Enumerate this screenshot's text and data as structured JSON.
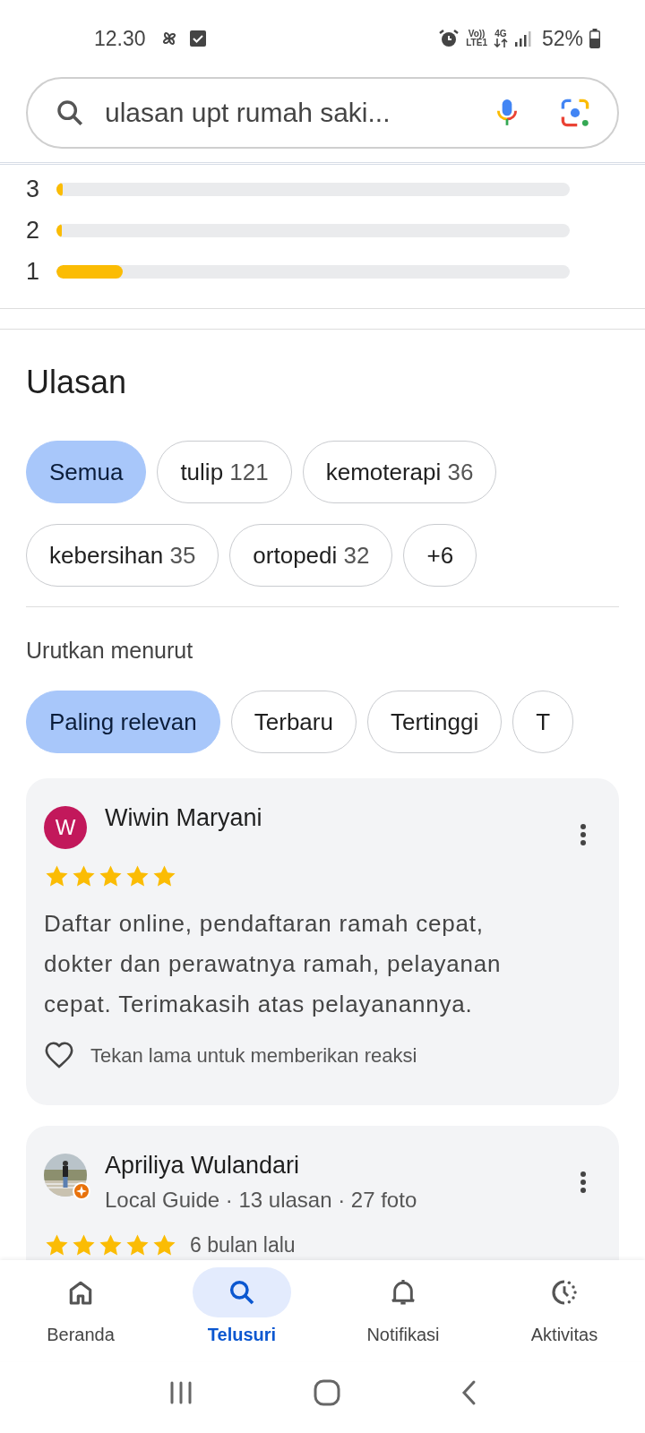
{
  "status_bar": {
    "time": "12.30",
    "volte_top": "Vo))",
    "volte_bottom": "LTE1",
    "network": "4G",
    "battery": "52%"
  },
  "search": {
    "value": "ulasan upt rumah saki..."
  },
  "rating_bars": [
    {
      "label": "3",
      "level": 0.012
    },
    {
      "label": "2",
      "level": 0.01
    },
    {
      "label": "1",
      "level": 0.13
    }
  ],
  "reviews_section": {
    "title": "Ulasan",
    "topics": [
      {
        "label": "Semua",
        "selected": true
      },
      {
        "label": "tulip",
        "count": "121",
        "selected": false
      },
      {
        "label": "kemoterapi",
        "count": "36",
        "selected": false
      },
      {
        "label": "kebersihan",
        "count": "35",
        "selected": false
      },
      {
        "label": "ortopedi",
        "count": "32",
        "selected": false
      },
      {
        "label": "+6",
        "selected": false
      }
    ]
  },
  "sort": {
    "label": "Urutkan menurut",
    "options": [
      {
        "label": "Paling relevan",
        "selected": true
      },
      {
        "label": "Terbaru",
        "selected": false
      },
      {
        "label": "Tertinggi",
        "selected": false
      },
      {
        "label": "T",
        "selected": false
      }
    ]
  },
  "reviews": [
    {
      "name": "Wiwin Maryani",
      "avatar": {
        "kind": "initial",
        "initial": "W",
        "color": "#c2185b"
      },
      "stars": 5,
      "text": "Daftar online, pendaftaran ramah cepat, dokter dan perawatnya ramah, pelayanan cepat. Terimakasih atas pelayanannya.",
      "reaction_hint": "Tekan lama untuk memberikan reaksi"
    },
    {
      "name": "Apriliya Wulandari",
      "local_guide": true,
      "meta": "Local Guide · 13 ulasan · 27 foto",
      "stars": 5,
      "time": "6 bulan lalu"
    }
  ],
  "bottom_nav": [
    {
      "kind": "home",
      "label": "Beranda",
      "selected": false
    },
    {
      "kind": "search",
      "label": "Telusuri",
      "selected": true
    },
    {
      "kind": "bell",
      "label": "Notifikasi",
      "selected": false
    },
    {
      "kind": "activity",
      "label": "Aktivitas",
      "selected": false
    }
  ]
}
